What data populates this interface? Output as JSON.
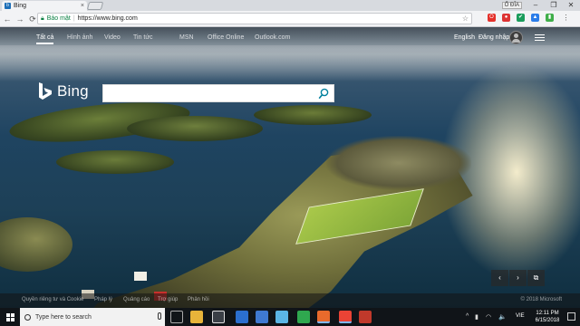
{
  "browser": {
    "tab_title": "Bing",
    "tab_close": "×",
    "profile_name": "Ổ ĐĨA",
    "window": {
      "minimize": "–",
      "maximize": "❐",
      "close": "✕"
    },
    "nav": {
      "back": "←",
      "forward": "→",
      "reload": "⟳"
    },
    "secure_label": "Bảo mật",
    "url": "https://www.bing.com",
    "star": "☆"
  },
  "bing": {
    "nav_items": [
      "Tất cả",
      "Hình ảnh",
      "Video",
      "Tin tức",
      "MSN",
      "Office Online",
      "Outlook.com"
    ],
    "language": "English",
    "signin": "Đăng nhập",
    "logo_text": "Bing",
    "search": {
      "value": "",
      "placeholder": ""
    },
    "image_controls": [
      "‹",
      "›",
      "⧉"
    ],
    "footer_links": [
      "Quyền riêng tư và Cookie",
      "Pháp lý",
      "Quảng cáo",
      "Trợ giúp",
      "Phản hồi"
    ],
    "copyright": "© 2018 Microsoft"
  },
  "taskbar": {
    "search_placeholder": "Type here to search",
    "apps": [
      "task-view",
      "file-explorer",
      "store",
      "edge",
      "app-5",
      "app-6",
      "chrome",
      "app-8",
      "app-9"
    ],
    "tray": {
      "up_arrow": "^",
      "battery": "▮",
      "wifi": "◠",
      "volume": "🔈",
      "language": "VIE"
    },
    "time": "12:11 PM",
    "date": "6/15/2018"
  },
  "colors": {
    "bing_accent": "#00809d",
    "taskbar_bg": "#101418",
    "secure_green": "#0b8043"
  }
}
